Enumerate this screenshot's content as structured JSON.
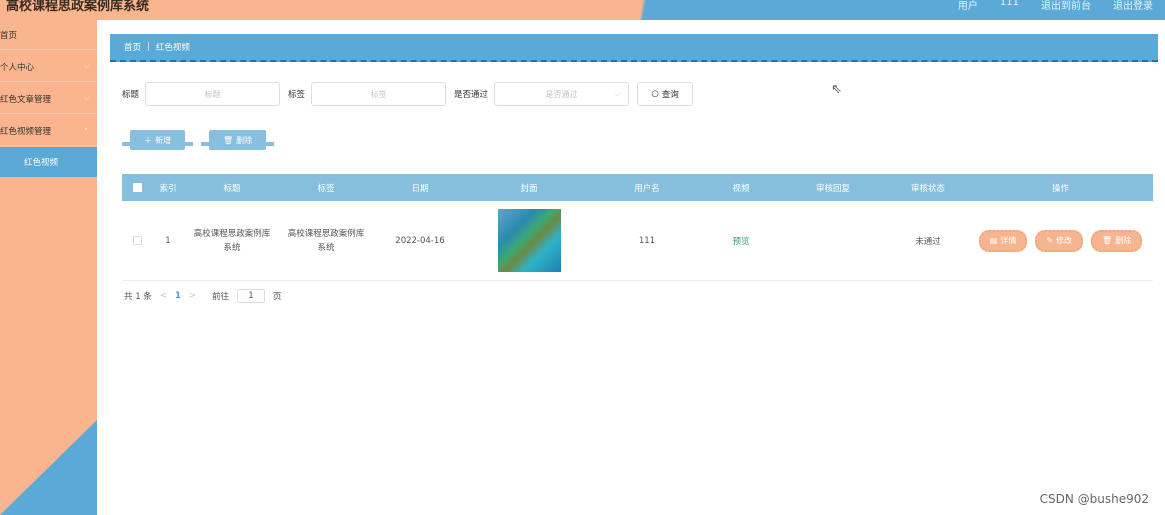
{
  "header": {
    "title": "高校课程思政案例库系统",
    "right_items": [
      "用户",
      "111",
      "退出到前台",
      "退出登录"
    ]
  },
  "sidebar": {
    "items": [
      {
        "label": "首页",
        "has_arrow": false
      },
      {
        "label": "个人中心",
        "has_arrow": true
      },
      {
        "label": "红色文章管理",
        "has_arrow": true
      },
      {
        "label": "红色视频管理",
        "has_arrow": true
      },
      {
        "label": "红色视频",
        "active": true
      }
    ]
  },
  "breadcrumb": {
    "home": "首页",
    "sep": "|",
    "current": "红色视频"
  },
  "search": {
    "title_label": "标题",
    "title_placeholder": "标题",
    "tag_label": "标签",
    "tag_placeholder": "标签",
    "passed_label": "是否通过",
    "passed_placeholder": "是否通过",
    "query_button": "查询"
  },
  "actions": {
    "add_label": "新增",
    "delete_label": "删除"
  },
  "table": {
    "headers": [
      "",
      "索引",
      "标题",
      "标签",
      "日期",
      "封面",
      "用户名",
      "视频",
      "审核回复",
      "审核状态",
      "操作"
    ],
    "rows": [
      {
        "index": "1",
        "title": "高校课程思政案例库系统",
        "tag": "高校课程思政案例库系统",
        "date": "2022-04-16",
        "username": "111",
        "video": "预览",
        "reply": "",
        "status": "未通过",
        "ops": [
          "详情",
          "修改",
          "删除"
        ]
      }
    ]
  },
  "pagination": {
    "total": "共 1 条",
    "prev": "<",
    "page": "1",
    "next": ">",
    "goto_label": "前往",
    "goto_value": "1",
    "page_suffix": "页"
  },
  "watermark": "CSDN @bushe902",
  "colors": {
    "accent_blue": "#5aa9d6",
    "peach": "#fab58e",
    "table_header": "#86bede"
  }
}
